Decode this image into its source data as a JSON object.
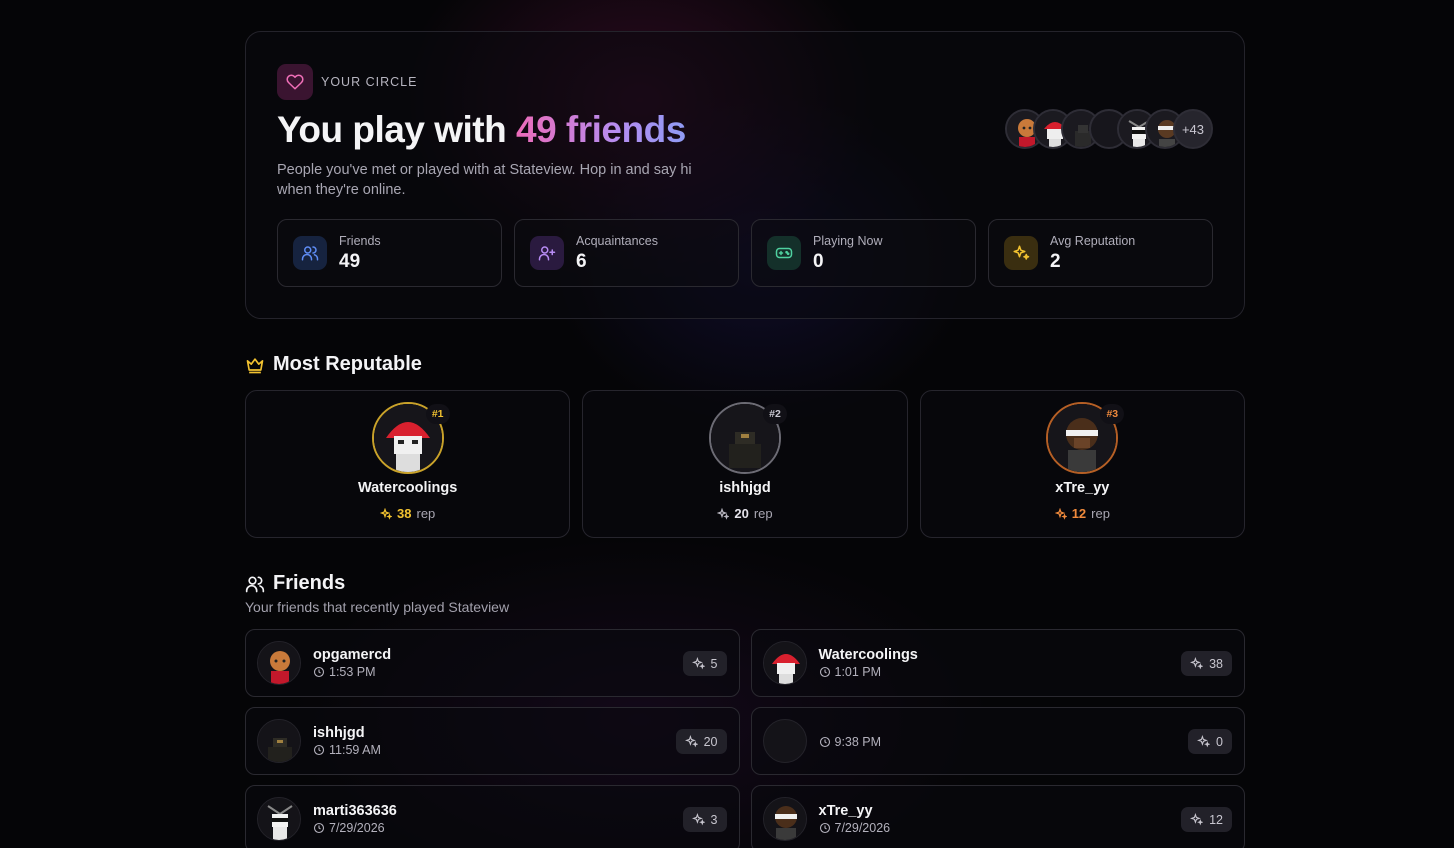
{
  "hero": {
    "eyebrow": "YOUR CIRCLE",
    "title_prefix": "You play with ",
    "title_accent": "49 friends",
    "description": "People you've met or played with at Stateview. Hop in and say hi when they're online.",
    "avatar_overflow": "+43",
    "stats": [
      {
        "label": "Friends",
        "value": "49",
        "icon": "users-icon",
        "color": "#5f8df5",
        "bg": "#16233f"
      },
      {
        "label": "Acquaintances",
        "value": "6",
        "icon": "user-plus-icon",
        "color": "#b88cf5",
        "bg": "#2a1a3f"
      },
      {
        "label": "Playing Now",
        "value": "0",
        "icon": "gamepad-icon",
        "color": "#4fd1a0",
        "bg": "#14302a"
      },
      {
        "label": "Avg Reputation",
        "value": "2",
        "icon": "sparkles-icon",
        "color": "#f2c230",
        "bg": "#3a2e10"
      }
    ]
  },
  "reputable": {
    "title": "Most Reputable",
    "suffix": "rep",
    "cards": [
      {
        "rank": "#1",
        "name": "Watercoolings",
        "score": "38",
        "color": "#f2c230"
      },
      {
        "rank": "#2",
        "name": "ishhjgd",
        "score": "20",
        "color": "#c9c7d1"
      },
      {
        "rank": "#3",
        "name": "xTre_yy",
        "score": "12",
        "color": "#f08a3c"
      }
    ]
  },
  "friends": {
    "title": "Friends",
    "subtitle": "Your friends that recently played Stateview",
    "items": [
      {
        "name": "opgamercd",
        "time": "1:53 PM",
        "rep": "5"
      },
      {
        "name": "Watercoolings",
        "time": "1:01 PM",
        "rep": "38"
      },
      {
        "name": "ishhjgd",
        "time": "11:59 AM",
        "rep": "20"
      },
      {
        "name": "",
        "time": "9:38 PM",
        "rep": "0"
      },
      {
        "name": "marti363636",
        "time": "7/29/2026",
        "rep": "3"
      },
      {
        "name": "xTre_yy",
        "time": "7/29/2026",
        "rep": "12"
      }
    ]
  },
  "colors": {
    "accent_pink": "#ec6bb9",
    "accent_violet": "#8f9bf5",
    "gold": "#f2c230"
  }
}
